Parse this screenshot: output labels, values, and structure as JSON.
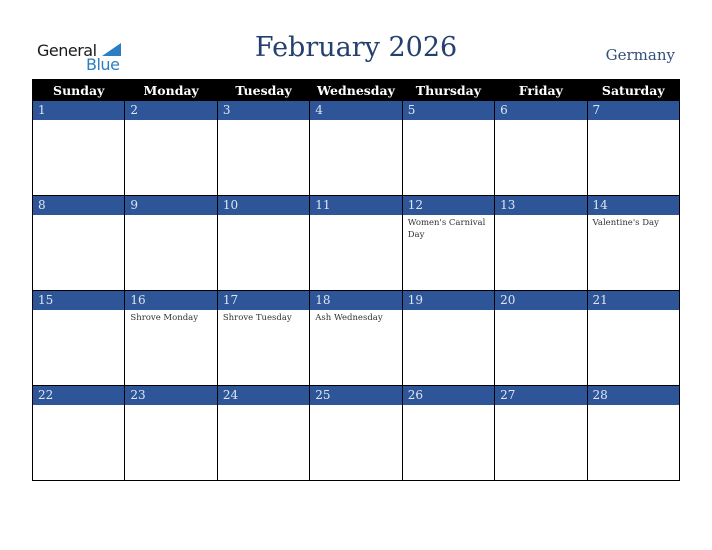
{
  "logo": {
    "line1": "General",
    "line2": "Blue",
    "accent_color": "#2a7fc4"
  },
  "header": {
    "title": "February 2026",
    "country": "Germany"
  },
  "calendar": {
    "weekdays": [
      "Sunday",
      "Monday",
      "Tuesday",
      "Wednesday",
      "Thursday",
      "Friday",
      "Saturday"
    ],
    "band_color": "#2e5597",
    "weeks": [
      [
        {
          "day": "1",
          "event": ""
        },
        {
          "day": "2",
          "event": ""
        },
        {
          "day": "3",
          "event": ""
        },
        {
          "day": "4",
          "event": ""
        },
        {
          "day": "5",
          "event": ""
        },
        {
          "day": "6",
          "event": ""
        },
        {
          "day": "7",
          "event": ""
        }
      ],
      [
        {
          "day": "8",
          "event": ""
        },
        {
          "day": "9",
          "event": ""
        },
        {
          "day": "10",
          "event": ""
        },
        {
          "day": "11",
          "event": ""
        },
        {
          "day": "12",
          "event": "Women's Carnival Day"
        },
        {
          "day": "13",
          "event": ""
        },
        {
          "day": "14",
          "event": "Valentine's Day"
        }
      ],
      [
        {
          "day": "15",
          "event": ""
        },
        {
          "day": "16",
          "event": "Shrove Monday"
        },
        {
          "day": "17",
          "event": "Shrove Tuesday"
        },
        {
          "day": "18",
          "event": "Ash Wednesday"
        },
        {
          "day": "19",
          "event": ""
        },
        {
          "day": "20",
          "event": ""
        },
        {
          "day": "21",
          "event": ""
        }
      ],
      [
        {
          "day": "22",
          "event": ""
        },
        {
          "day": "23",
          "event": ""
        },
        {
          "day": "24",
          "event": ""
        },
        {
          "day": "25",
          "event": ""
        },
        {
          "day": "26",
          "event": ""
        },
        {
          "day": "27",
          "event": ""
        },
        {
          "day": "28",
          "event": ""
        }
      ]
    ]
  }
}
